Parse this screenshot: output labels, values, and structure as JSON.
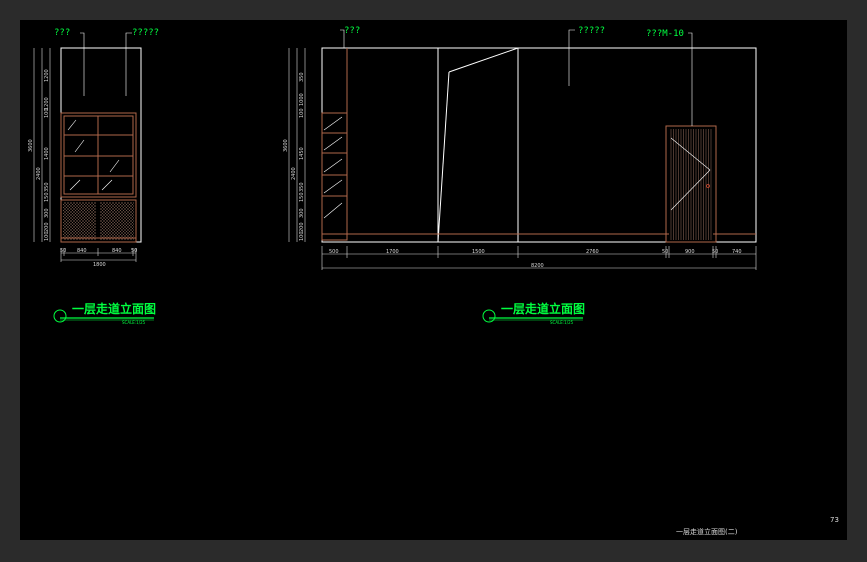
{
  "left_view": {
    "callout_a": "???",
    "callout_b": "?????",
    "vdims": [
      "1200",
      "1200",
      "100",
      "1400",
      "350",
      "150",
      "300",
      "200",
      "100"
    ],
    "vdim_totals": [
      "3600",
      "2400"
    ],
    "hdims": [
      "50",
      "840",
      "840",
      "50"
    ],
    "htotal": "1800",
    "title": "一层走道立面图",
    "scale": "SCALE:1/25"
  },
  "right_view": {
    "callout_a": "???",
    "callout_b": "?????",
    "callout_c": "???M-10",
    "vdims": [
      "350",
      "1000",
      "100",
      "1450",
      "350",
      "150",
      "300",
      "200",
      "100"
    ],
    "vdim_totals": [
      "3600",
      "2400"
    ],
    "hdims": [
      "500",
      "1700",
      "1500",
      "2760",
      "50",
      "900",
      "50",
      "740"
    ],
    "htotal": "8200",
    "title": "一层走道立面图",
    "scale": "SCALE:1/25"
  },
  "sheet": {
    "page_number": "73",
    "footer_title": "一层走道立面图(二)"
  },
  "colors": {
    "background": "#000000",
    "frame": "#2b2b2b",
    "text_green": "#00ff40",
    "line_white": "#ffffff",
    "furniture": "#b0674a"
  }
}
